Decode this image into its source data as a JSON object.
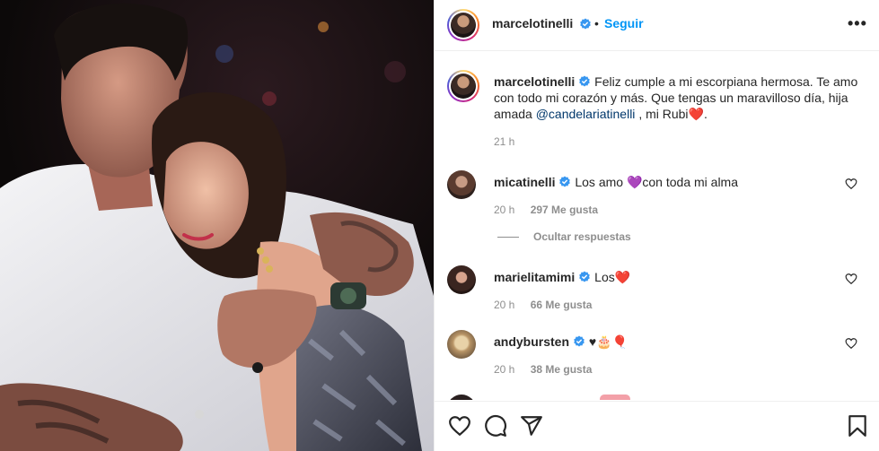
{
  "post": {
    "author": "marcelotinelli",
    "follow_label": "Seguir",
    "separator": "•",
    "more_label": "•••",
    "verified": true
  },
  "caption": {
    "username": "marcelotinelli",
    "text_part1": "Feliz cumple a mi escorpiana hermosa. Te amo con todo mi corazón y más. Que tengas un maravilloso día, hija amada",
    "mention": "@candelariatinelli",
    "text_part2": ", mi Rubi",
    "emoji": "❤️",
    "text_end": ".",
    "time": "21 h"
  },
  "comments": [
    {
      "username": "micatinelli",
      "text": "Los amo",
      "emoji": "💜",
      "text_after": "con toda mi alma",
      "time": "20 h",
      "likes": "297 Me gusta"
    },
    {
      "username": "marielitamimi",
      "text": "Los",
      "emoji": "❤️",
      "text_after": "",
      "time": "20 h",
      "likes": "66 Me gusta"
    },
    {
      "username": "andybursten",
      "text": "",
      "emoji": "♥🎂🎈",
      "text_after": "",
      "time": "20 h",
      "likes": "38 Me gusta"
    }
  ],
  "replies_toggle": "Ocultar respuestas",
  "icons": {
    "like": "heart-outline-icon",
    "comment": "speech-bubble-icon",
    "share": "paper-plane-icon",
    "save": "bookmark-icon",
    "verified": "verified-badge-icon",
    "comment_like": "small-heart-icon"
  },
  "colors": {
    "link": "#0095f6",
    "mention": "#00376b",
    "muted": "#8e8e8e",
    "verified": "#3897f0"
  }
}
